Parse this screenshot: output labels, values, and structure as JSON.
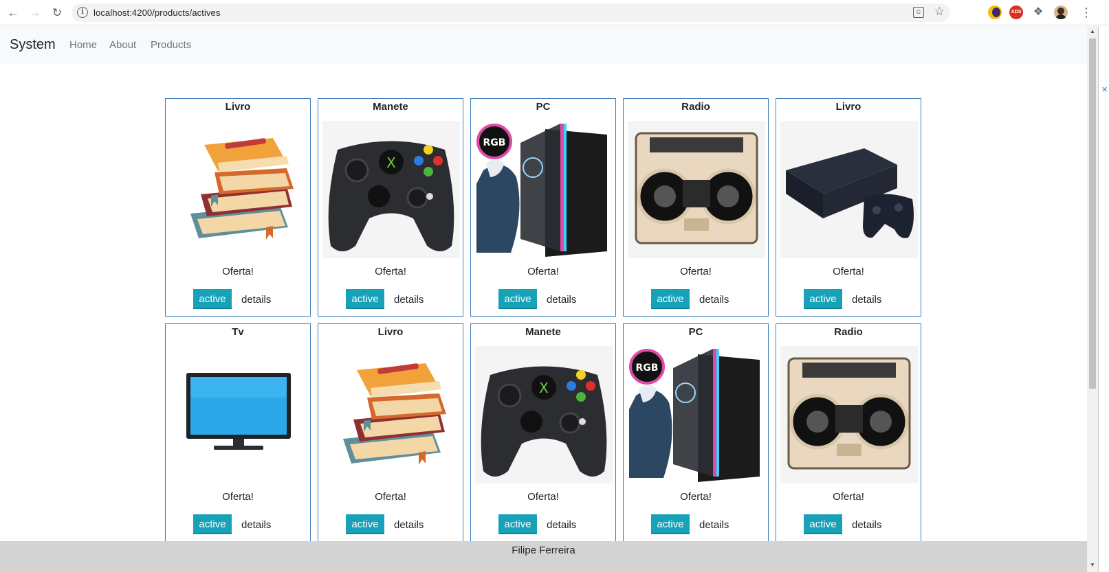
{
  "browser": {
    "url": "localhost:4200/products/actives"
  },
  "navbar": {
    "brand": "System",
    "links": [
      "Home",
      "About",
      "Products"
    ]
  },
  "products": [
    {
      "name": "Livro",
      "image": "books-icon",
      "text": "Oferta!",
      "button": "active",
      "link": "details"
    },
    {
      "name": "Manete",
      "image": "gamepad-icon",
      "text": "Oferta!",
      "button": "active",
      "link": "details"
    },
    {
      "name": "PC",
      "image": "pc-tower-icon",
      "text": "Oferta!",
      "button": "active",
      "link": "details"
    },
    {
      "name": "Radio",
      "image": "boombox-icon",
      "text": "Oferta!",
      "button": "active",
      "link": "details"
    },
    {
      "name": "Livro",
      "image": "console-icon",
      "text": "Oferta!",
      "button": "active",
      "link": "details"
    },
    {
      "name": "Tv",
      "image": "tv-icon",
      "text": "Oferta!",
      "button": "active",
      "link": "details"
    },
    {
      "name": "Livro",
      "image": "books-icon",
      "text": "Oferta!",
      "button": "active",
      "link": "details"
    },
    {
      "name": "Manete",
      "image": "gamepad-icon",
      "text": "Oferta!",
      "button": "active",
      "link": "details"
    },
    {
      "name": "PC",
      "image": "pc-tower-icon",
      "text": "Oferta!",
      "button": "active",
      "link": "details"
    },
    {
      "name": "Radio",
      "image": "boombox-icon",
      "text": "Oferta!",
      "button": "active",
      "link": "details"
    }
  ],
  "footer": {
    "text": "Filipe Ferreira"
  },
  "colors": {
    "button": "#17a2b8",
    "card_border": "#3a7ab8",
    "navbar_bg": "#f8f9fa",
    "footer_bg": "#d3d3d3"
  }
}
